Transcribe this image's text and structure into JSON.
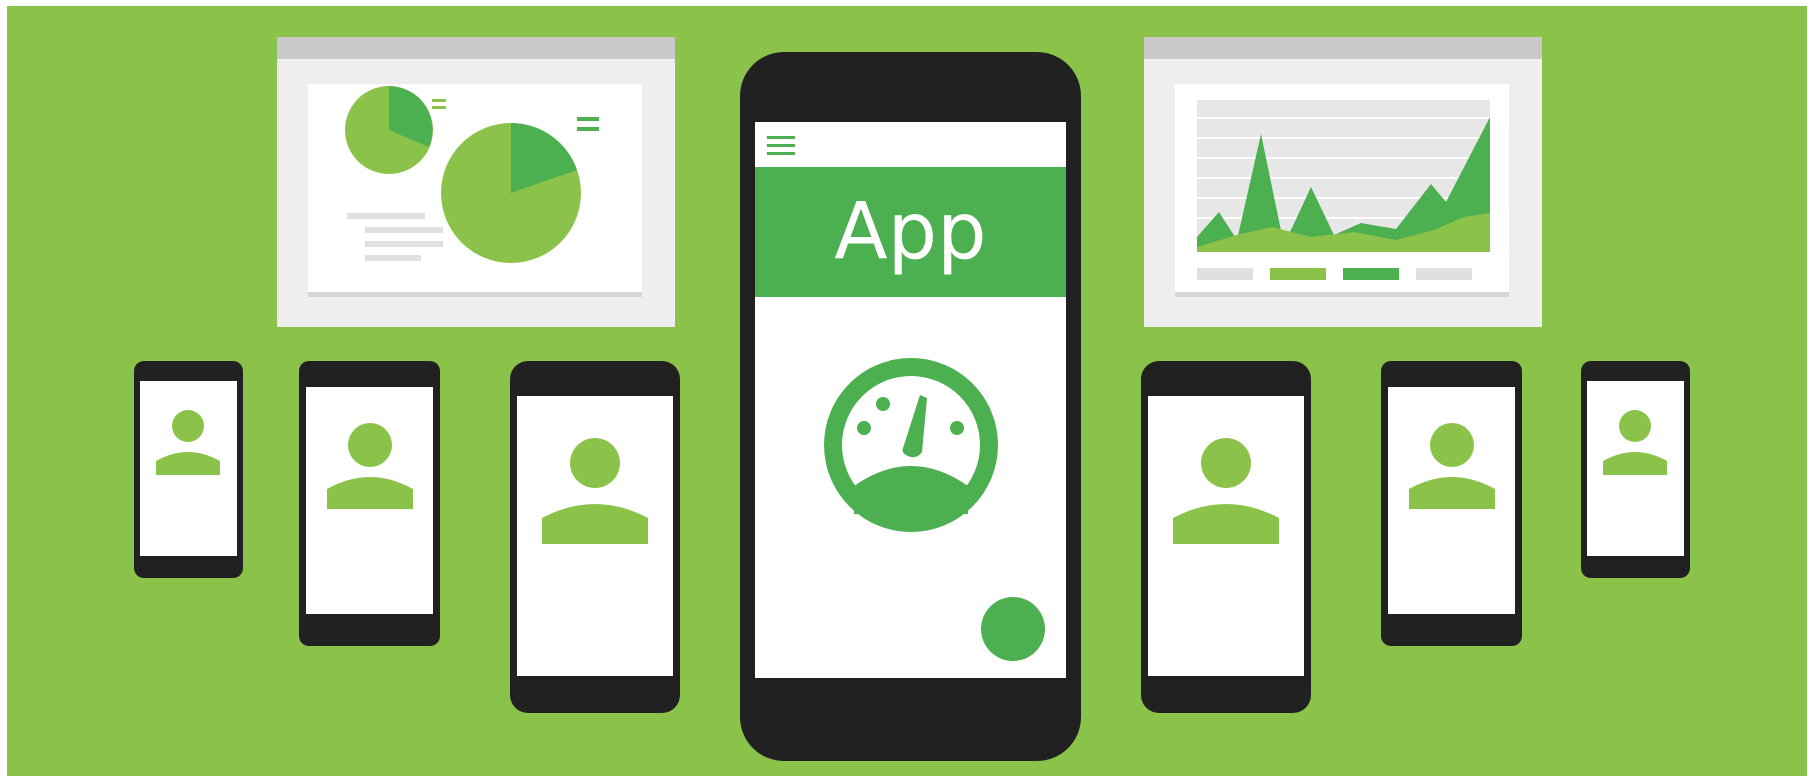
{
  "app": {
    "title": "App"
  },
  "icons": {
    "menu": "hamburger-menu-icon",
    "speedometer": "speedometer-icon",
    "fab": "floating-action-button",
    "user": "user-avatar-icon",
    "pie": "pie-chart-icon",
    "line": "area-chart-icon"
  },
  "colors": {
    "background": "#8bc34a",
    "accent": "#4caf50",
    "device": "#212121",
    "screen": "#ffffff",
    "panel": "#eeeeee"
  }
}
